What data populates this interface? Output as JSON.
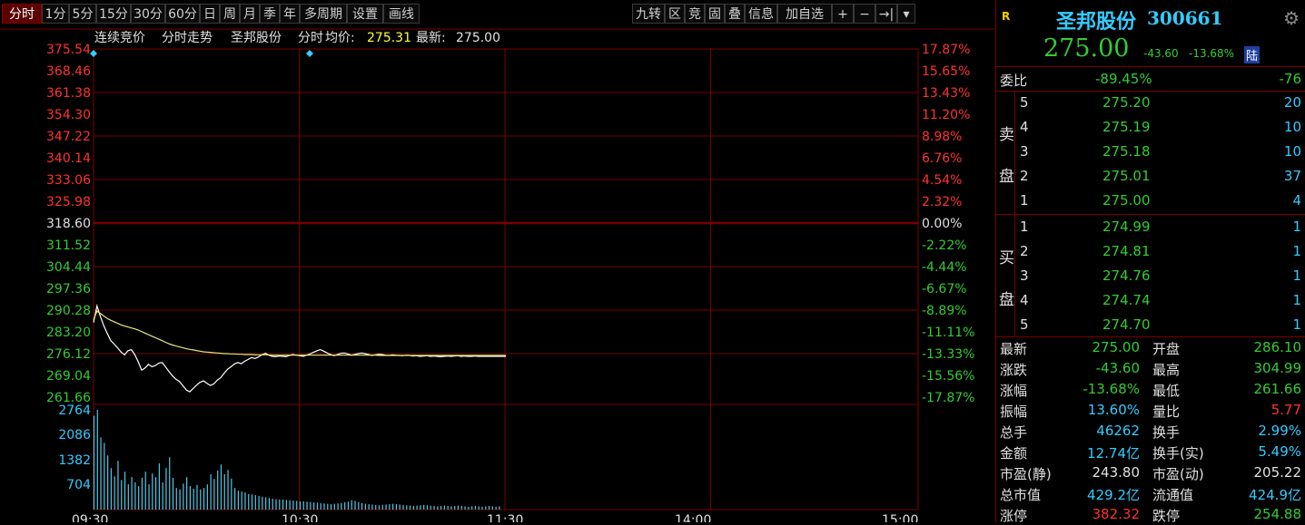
{
  "toolbar": {
    "periods": [
      "分时",
      "1分",
      "5分",
      "15分",
      "30分",
      "60分",
      "日",
      "周",
      "月",
      "季",
      "年",
      "多周期",
      "设置",
      "画线"
    ],
    "active_period": "分时",
    "right_buttons": [
      "九转",
      "区",
      "竞",
      "固",
      "叠",
      "信息",
      "加自选",
      "+",
      "−",
      "→|",
      "▾"
    ]
  },
  "chart_header": {
    "mode_a": "连续竞价",
    "mode_b": "分时走势",
    "stock": "圣邦股份",
    "kind": "分时",
    "avg_label": "均价:",
    "avg_value": "275.31",
    "last_label": "最新:",
    "last_value": "275.00"
  },
  "colors": {
    "up": "#ff3232",
    "down": "#33cc33",
    "flat": "#e0e0e0",
    "grid": "#7a0000",
    "price_line": "#ffffff",
    "avg_line": "#e8e878",
    "volume": "#52c8e6",
    "yellow": "#ffff33",
    "cyan": "#33ccff"
  },
  "chart_data": {
    "type": "line",
    "ylim": [
      261.66,
      375.54
    ],
    "prev_close": 318.6,
    "left_ticks": [
      "375.54",
      "368.46",
      "361.38",
      "354.30",
      "347.22",
      "340.14",
      "333.06",
      "325.98",
      "318.60",
      "311.52",
      "304.44",
      "297.36",
      "290.28",
      "283.20",
      "276.12",
      "269.04",
      "261.66"
    ],
    "right_ticks": [
      "17.87%",
      "15.65%",
      "13.43%",
      "11.20%",
      "8.98%",
      "6.76%",
      "4.54%",
      "2.32%",
      "0.00%",
      "-2.22%",
      "-4.44%",
      "-6.67%",
      "-8.89%",
      "-11.11%",
      "-13.33%",
      "-15.56%",
      "-17.87%"
    ],
    "x_ticks": [
      "09:30",
      "10:30",
      "11:30",
      "14:00",
      "15:00"
    ],
    "total_minutes": 240,
    "series": [
      {
        "values": [
          286.1,
          291.5,
          288.0,
          285.0,
          282.5,
          280.2,
          279.0,
          277.8,
          276.4,
          275.5,
          276.8,
          277.2,
          275.6,
          273.2,
          270.5,
          271.2,
          272.4,
          271.6,
          272.0,
          272.8,
          273.0,
          271.5,
          270.0,
          268.6,
          267.5,
          266.8,
          265.4,
          264.0,
          263.4,
          264.5,
          265.6,
          266.5,
          267.0,
          266.2,
          265.5,
          266.0,
          267.2,
          268.0,
          269.5,
          270.8,
          271.6,
          272.5,
          273.0,
          272.6,
          273.4,
          274.0,
          274.6,
          274.3,
          274.8,
          275.5,
          276.0,
          275.4,
          275.0,
          274.9,
          275.1,
          275.0,
          274.9,
          275.3,
          275.6,
          275.4,
          275.2,
          275.0,
          275.4,
          275.8,
          276.3,
          276.8,
          277.2,
          276.7,
          276.1,
          275.6,
          275.2,
          275.6,
          276.0,
          276.1,
          275.8,
          275.4,
          275.6,
          275.9,
          276.1,
          275.9,
          275.6,
          275.3,
          275.5,
          275.7,
          275.6,
          275.4,
          275.3,
          275.5,
          275.4,
          275.3,
          275.2,
          275.4,
          275.3,
          275.1,
          275.2,
          275.0,
          275.1,
          275.2,
          275.0,
          275.1,
          275.0,
          274.9,
          275.0,
          275.1,
          275.0,
          275.1,
          275.2,
          275.0,
          275.1,
          275.0,
          275.0,
          275.1,
          275.0,
          275.0,
          275.0,
          275.0,
          275.0,
          275.0,
          275.0,
          275.0,
          275.0
        ]
      },
      {
        "values": [
          287.0,
          289.8,
          289.0,
          288.2,
          287.4,
          286.8,
          286.3,
          285.8,
          285.3,
          284.9,
          284.6,
          284.3,
          284.0,
          283.6,
          283.1,
          282.6,
          282.1,
          281.6,
          281.1,
          280.6,
          280.1,
          279.6,
          279.1,
          278.7,
          278.4,
          278.1,
          277.8,
          277.5,
          277.3,
          277.1,
          276.9,
          276.7,
          276.5,
          276.4,
          276.3,
          276.2,
          276.1,
          276.0,
          275.9,
          275.9,
          275.8,
          275.8,
          275.7,
          275.7,
          275.6,
          275.6,
          275.6,
          275.5,
          275.5,
          275.5,
          275.5,
          275.5,
          275.4,
          275.4,
          275.4,
          275.4,
          275.4,
          275.4,
          275.4,
          275.4,
          275.4,
          275.4,
          275.4,
          275.4,
          275.4,
          275.4,
          275.4,
          275.4,
          275.4,
          275.4,
          275.4,
          275.4,
          275.4,
          275.4,
          275.4,
          275.4,
          275.4,
          275.4,
          275.4,
          275.4,
          275.4,
          275.4,
          275.4,
          275.3,
          275.3,
          275.3,
          275.3,
          275.3,
          275.3,
          275.3,
          275.3,
          275.3,
          275.3,
          275.3,
          275.3,
          275.3,
          275.3,
          275.3,
          275.3,
          275.3,
          275.3,
          275.3,
          275.3,
          275.3,
          275.3,
          275.3,
          275.3,
          275.3,
          275.3,
          275.3,
          275.3,
          275.3,
          275.3,
          275.3,
          275.3,
          275.3,
          275.3,
          275.3,
          275.3,
          275.3,
          275.3
        ]
      }
    ],
    "volume": {
      "ticks": [
        "2764",
        "2086",
        "1382",
        "704"
      ],
      "ylim": [
        0,
        2764
      ],
      "values": [
        2600,
        2764,
        2000,
        1850,
        1500,
        1150,
        920,
        1350,
        820,
        1050,
        700,
        900,
        760,
        650,
        880,
        1050,
        700,
        1000,
        900,
        1280,
        750,
        1150,
        1450,
        880,
        600,
        560,
        720,
        900,
        650,
        580,
        680,
        560,
        600,
        700,
        980,
        850,
        1080,
        1250,
        980,
        1100,
        860,
        600,
        520,
        500,
        480,
        430,
        420,
        400,
        380,
        360,
        340,
        320,
        300,
        290,
        280,
        280,
        270,
        260,
        250,
        240,
        230,
        230,
        220,
        210,
        200,
        190,
        180,
        170,
        160,
        150,
        160,
        170,
        180,
        200,
        220,
        260,
        240,
        210,
        180,
        160,
        150,
        140,
        130,
        120,
        130,
        140,
        150,
        160,
        150,
        140,
        130,
        120,
        110,
        100,
        110,
        120,
        130,
        120,
        110,
        100,
        90,
        100,
        110,
        100,
        90,
        100,
        110,
        100,
        90,
        80,
        90,
        100,
        90,
        80,
        90,
        100,
        90,
        80,
        90
      ]
    }
  },
  "quote": {
    "badge": "R",
    "name": "圣邦股份",
    "code": "300661",
    "price": "275.00",
    "change": "-43.60",
    "change_pct": "-13.68%",
    "tag": "陆",
    "weibi_label": "委比",
    "weibi_pct": "-89.45%",
    "weibi_diff": "-76",
    "sell_label": [
      "卖",
      "盘"
    ],
    "buy_label": [
      "买",
      "盘"
    ],
    "sells": [
      {
        "level": "5",
        "price": "275.20",
        "vol": "20"
      },
      {
        "level": "4",
        "price": "275.19",
        "vol": "10"
      },
      {
        "level": "3",
        "price": "275.18",
        "vol": "10"
      },
      {
        "level": "2",
        "price": "275.01",
        "vol": "37"
      },
      {
        "level": "1",
        "price": "275.00",
        "vol": "4"
      }
    ],
    "buys": [
      {
        "level": "1",
        "price": "274.99",
        "vol": "1"
      },
      {
        "level": "2",
        "price": "274.81",
        "vol": "1"
      },
      {
        "level": "3",
        "price": "274.76",
        "vol": "1"
      },
      {
        "level": "4",
        "price": "274.74",
        "vol": "1"
      },
      {
        "level": "5",
        "price": "274.70",
        "vol": "1"
      }
    ],
    "stats": [
      {
        "l1": "最新",
        "v1": "275.00",
        "c1": "down",
        "l2": "开盘",
        "v2": "286.10",
        "c2": "down"
      },
      {
        "l1": "涨跌",
        "v1": "-43.60",
        "c1": "down",
        "l2": "最高",
        "v2": "304.99",
        "c2": "down"
      },
      {
        "l1": "涨幅",
        "v1": "-13.68%",
        "c1": "down",
        "l2": "最低",
        "v2": "261.66",
        "c2": "down"
      },
      {
        "l1": "振幅",
        "v1": "13.60%",
        "c1": "cyan",
        "l2": "量比",
        "v2": "5.77",
        "c2": "up"
      },
      {
        "l1": "总手",
        "v1": "46262",
        "c1": "cyan",
        "l2": "换手",
        "v2": "2.99%",
        "c2": "cyan"
      },
      {
        "l1": "金额",
        "v1": "12.74亿",
        "c1": "cyan",
        "l2": "换手(实)",
        "v2": "5.49%",
        "c2": "cyan"
      },
      {
        "l1": "市盈(静)",
        "v1": "243.80",
        "c1": "flat",
        "l2": "市盈(动)",
        "v2": "205.22",
        "c2": "flat"
      },
      {
        "l1": "总市值",
        "v1": "429.2亿",
        "c1": "cyan",
        "l2": "流通值",
        "v2": "424.9亿",
        "c2": "cyan"
      },
      {
        "l1": "涨停",
        "v1": "382.32",
        "c1": "up",
        "l2": "跌停",
        "v2": "254.88",
        "c2": "down"
      }
    ]
  }
}
